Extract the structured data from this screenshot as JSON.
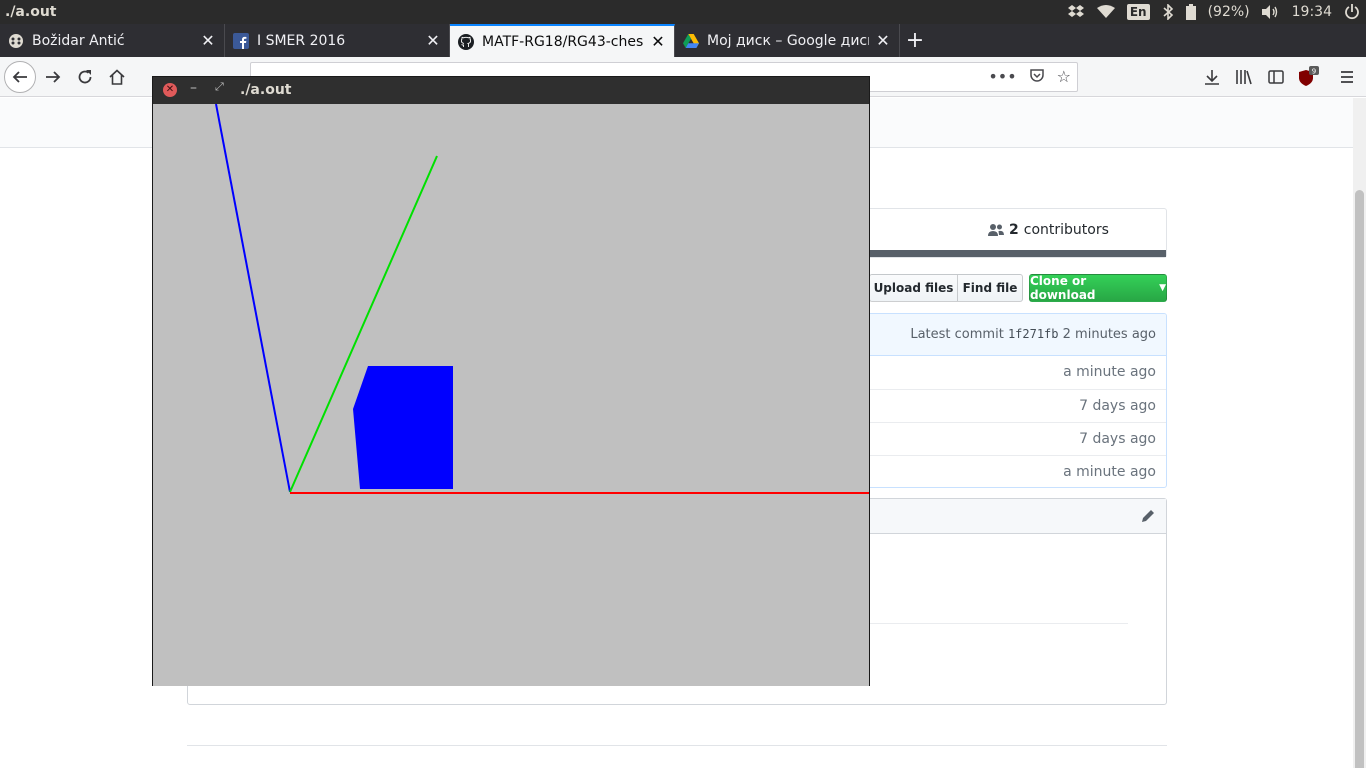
{
  "panel": {
    "title": "./a.out",
    "keyboard_layout": "En",
    "battery": "(92%)",
    "clock": "19:34",
    "icons": [
      "dropbox-icon",
      "wifi-icon",
      "bluetooth-icon",
      "battery-icon",
      "volume-icon",
      "power-icon"
    ]
  },
  "browser": {
    "tabs": [
      {
        "label": "Božidar Antić",
        "icon": "messenger-favicon",
        "active": false
      },
      {
        "label": "I SMER 2016",
        "icon": "facebook-favicon",
        "active": false
      },
      {
        "label": "MATF-RG18/RG43-chess",
        "icon": "github-favicon",
        "active": true
      },
      {
        "label": "Мој диск – Google диск",
        "icon": "google-drive-favicon",
        "active": false
      }
    ],
    "new_tab_label": "+",
    "notification_badge": "9"
  },
  "github": {
    "contributors_count": "2",
    "contributors_label": "contributors",
    "upload_files_label": "Upload files",
    "find_file_label": "Find file",
    "clone_label": "Clone or download",
    "latest_commit_label": "Latest commit",
    "latest_commit_sha": "1f271fb",
    "latest_commit_age": "2 minutes ago",
    "file_ages": [
      "a minute ago",
      "7 days ago",
      "7 days ago",
      "a minute ago"
    ]
  },
  "app_window": {
    "title": "./a.out",
    "background_color": "#c0c0c0",
    "axis_colors": {
      "x": "#ff0000",
      "y": "#00e000",
      "z": "#0000ff"
    },
    "cube_color": "#0000ff"
  }
}
